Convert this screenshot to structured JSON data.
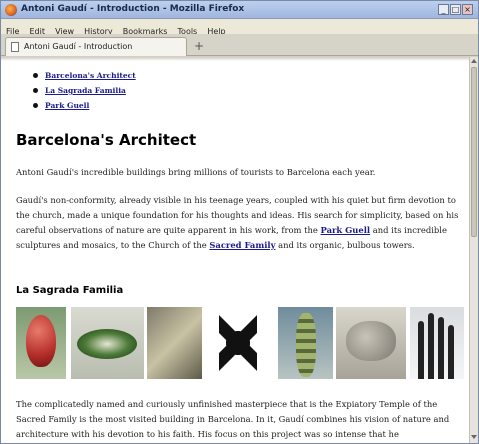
{
  "window": {
    "title": "Antoni Gaudí - Introduction - Mozilla Firefox",
    "controls": {
      "minimize": "_",
      "maximize": "□",
      "close": "×"
    }
  },
  "menubar": [
    "File",
    "Edit",
    "View",
    "History",
    "Bookmarks",
    "Tools",
    "Help"
  ],
  "tabs": [
    {
      "label": "Antoni Gaudí - Introduction"
    }
  ],
  "new_tab": "+",
  "page": {
    "nav_links": [
      "Barcelona's Architect",
      "La Sagrada Familia",
      "Park Guell"
    ],
    "heading": "Barcelona's Architect",
    "intro": "Antoni Gaudí's incredible buildings bring millions of tourists to Barcelona each year.",
    "para2_a": "Gaudí's non-conformity, already visible in his teenage years, coupled with his quiet but firm devotion to the church, made a unique foundation for his thoughts and ideas. His search for simplicity, based on his careful observations of nature are quite apparent in his work, from the ",
    "para2_link1": "Park Guell",
    "para2_b": " and its incredible sculptures and mosaics, to the Church of the ",
    "para2_link2": "Sacred Family",
    "para2_c": " and its organic, bulbous towers.",
    "subheading": "La Sagrada Familia",
    "para3": "The complicatedly named and curiously unfinished masterpiece that is the Expiatory Temple of the Sacred Family is the most visited building in Barcelona. In it, Gaudí combines his vision of nature and architecture with his devotion to his faith. His focus on this project was so intense that he"
  }
}
